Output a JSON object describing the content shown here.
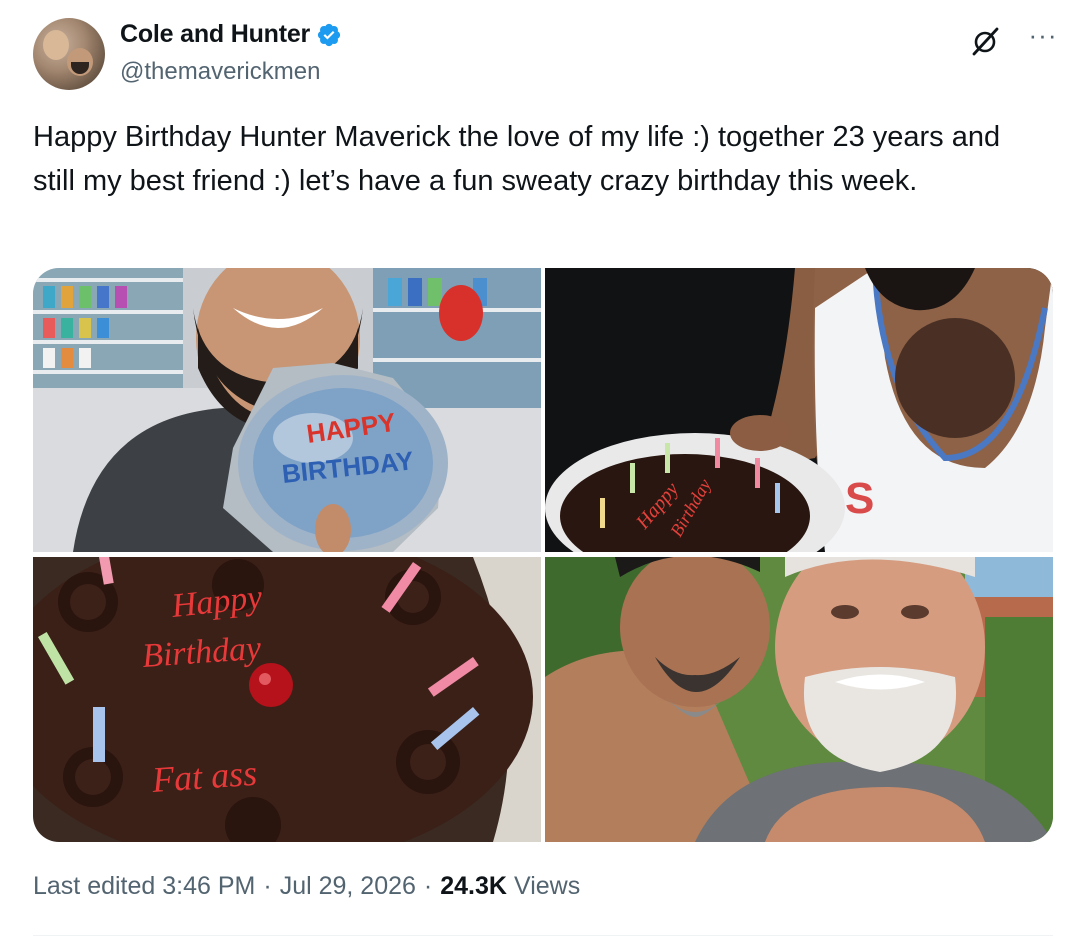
{
  "author": {
    "display_name": "Cole and Hunter",
    "handle": "@themaverickmen",
    "verified": true
  },
  "post": {
    "text": "Happy Birthday Hunter Maverick the love of my life :) together 23 years and still my best friend :) let’s have a fun sweaty crazy birthday this week.",
    "media": [
      {
        "id": "photo-1",
        "alt": "Bearded man in party store with Happy Birthday balloon",
        "balloon_text": "HAPPY BIRTHDAY"
      },
      {
        "id": "photo-2",
        "alt": "Man in white tank top holding chocolate birthday cake"
      },
      {
        "id": "photo-3",
        "alt": "Chocolate cake close-up",
        "cake_text_1": "Happy",
        "cake_text_2": "Birthday",
        "cake_text_3": "Fat ass"
      },
      {
        "id": "photo-4",
        "alt": "Two men selfie outdoors"
      }
    ]
  },
  "meta": {
    "edited_label": "Last edited 3:46 PM",
    "separator": "·",
    "date": "Jul 29, 2026",
    "views_count": "24.3K",
    "views_label": "Views"
  },
  "icons": {
    "verified": "verified-badge-icon",
    "grok": "grok-icon",
    "more": "more-icon"
  },
  "colors": {
    "verified_blue": "#1d9bf0",
    "text_primary": "#0f1419",
    "text_secondary": "#536471"
  }
}
